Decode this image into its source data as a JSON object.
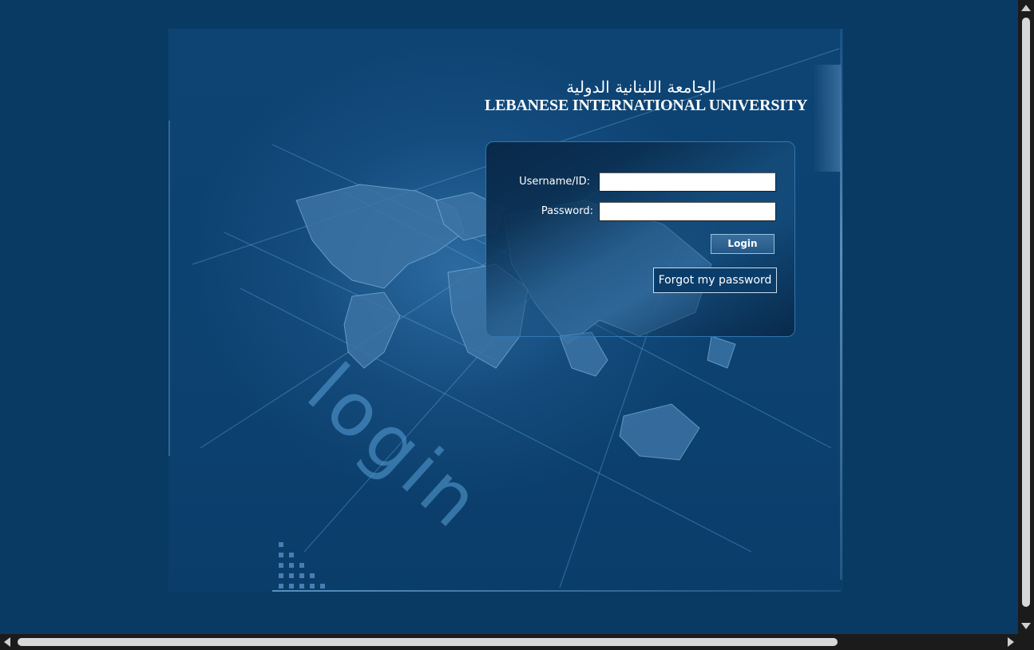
{
  "logo": {
    "arabic": "الجامعة اللبنانية الدولية",
    "english": "LEBANESE INTERNATIONAL UNIVERSITY"
  },
  "watermark": "login",
  "form": {
    "username_label": "Username/ID:",
    "username_value": "",
    "password_label": "Password:",
    "password_value": "",
    "login_button": "Login",
    "forgot_button": "Forgot my password"
  },
  "colors": {
    "background": "#093a64",
    "panel_border": "#2f78b1",
    "button_border": "#9ac1e0"
  }
}
